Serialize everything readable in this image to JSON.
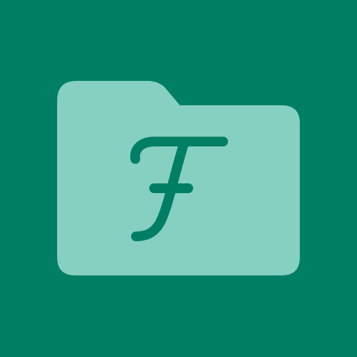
{
  "icon": {
    "name": "folder-with-script-f",
    "background_color": "#007f65",
    "folder_color": "#86d0c1",
    "glyph_color": "#007f65",
    "glyph_icon": "script-f-icon",
    "folder_icon": "folder-icon"
  }
}
